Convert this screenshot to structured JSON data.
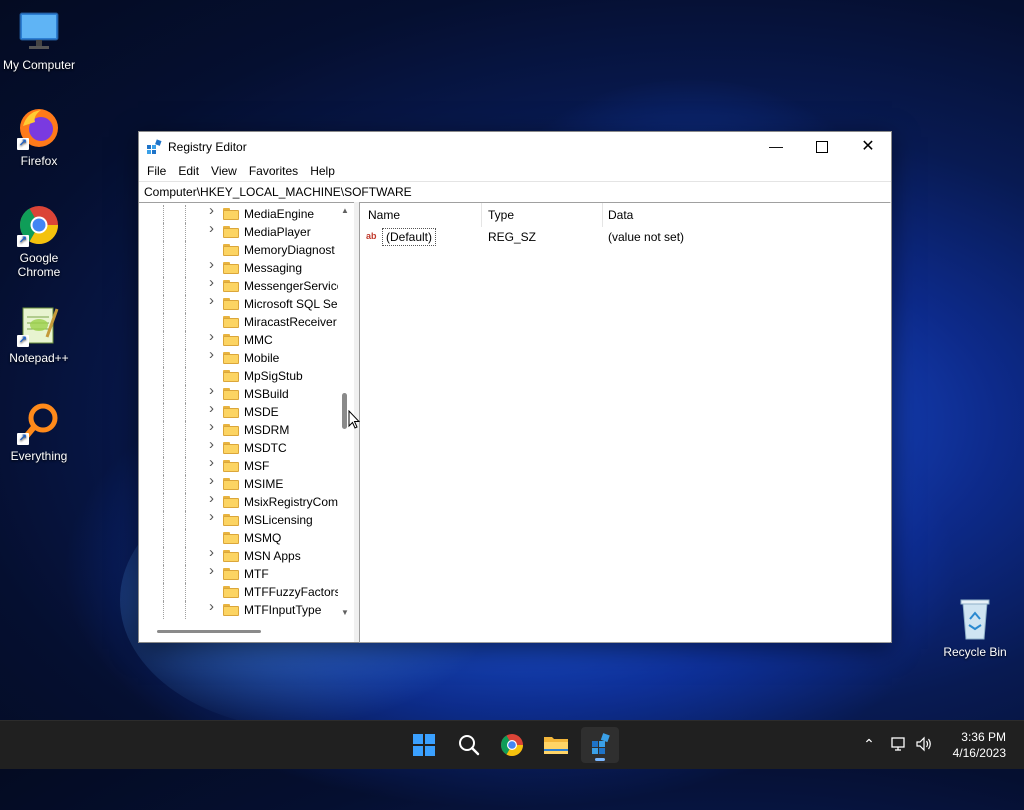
{
  "desktop": {
    "icons": [
      {
        "label": "My Computer"
      },
      {
        "label": "Firefox"
      },
      {
        "label": "Google Chrome"
      },
      {
        "label": "Notepad++"
      },
      {
        "label": "Everything"
      },
      {
        "label": "Recycle Bin"
      }
    ]
  },
  "window": {
    "title": "Registry Editor",
    "menu": [
      "File",
      "Edit",
      "View",
      "Favorites",
      "Help"
    ],
    "address": "Computer\\HKEY_LOCAL_MACHINE\\SOFTWARE",
    "tree": {
      "items": [
        {
          "label": "MediaEngine",
          "expandable": true
        },
        {
          "label": "MediaPlayer",
          "expandable": true
        },
        {
          "label": "MemoryDiagnost",
          "expandable": false
        },
        {
          "label": "Messaging",
          "expandable": true
        },
        {
          "label": "MessengerService",
          "expandable": true
        },
        {
          "label": "Microsoft SQL Se",
          "expandable": true
        },
        {
          "label": "MiracastReceiver",
          "expandable": false
        },
        {
          "label": "MMC",
          "expandable": true
        },
        {
          "label": "Mobile",
          "expandable": true
        },
        {
          "label": "MpSigStub",
          "expandable": false
        },
        {
          "label": "MSBuild",
          "expandable": true
        },
        {
          "label": "MSDE",
          "expandable": true
        },
        {
          "label": "MSDRM",
          "expandable": true
        },
        {
          "label": "MSDTC",
          "expandable": true
        },
        {
          "label": "MSF",
          "expandable": true
        },
        {
          "label": "MSIME",
          "expandable": true
        },
        {
          "label": "MsixRegistryCom",
          "expandable": true
        },
        {
          "label": "MSLicensing",
          "expandable": true
        },
        {
          "label": "MSMQ",
          "expandable": false
        },
        {
          "label": "MSN Apps",
          "expandable": true
        },
        {
          "label": "MTF",
          "expandable": true
        },
        {
          "label": "MTFFuzzyFactors",
          "expandable": false
        },
        {
          "label": "MTFInputType",
          "expandable": true
        }
      ]
    },
    "list": {
      "columns": [
        "Name",
        "Type",
        "Data"
      ],
      "rows": [
        {
          "name": "(Default)",
          "type": "REG_SZ",
          "data": "(value not set)"
        }
      ]
    }
  },
  "taskbar": {
    "time": "3:36 PM",
    "date": "4/16/2023"
  }
}
